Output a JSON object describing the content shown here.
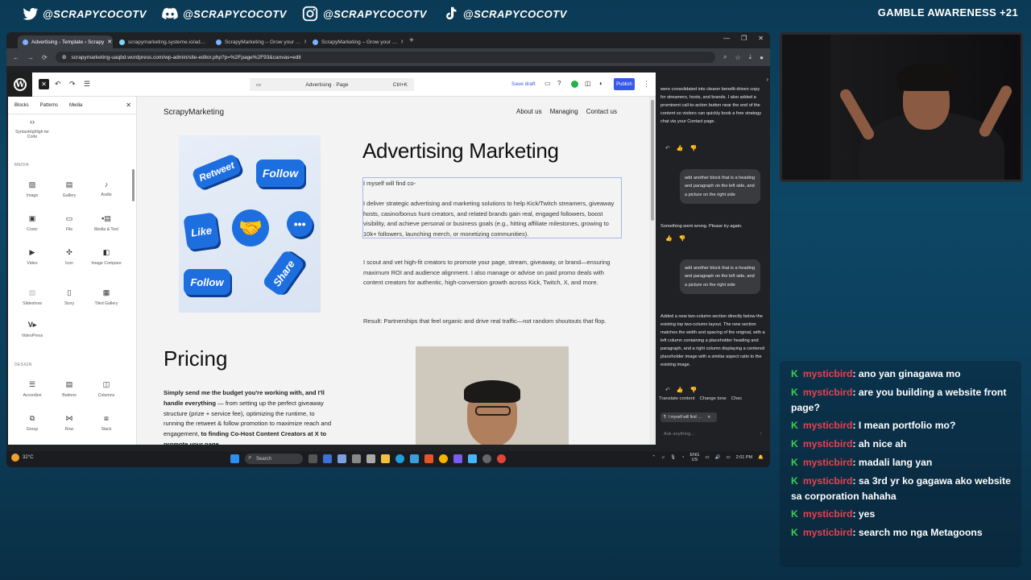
{
  "stream": {
    "handles": [
      {
        "icon": "twitter-icon",
        "text": "@SCRAPYCOCOTV"
      },
      {
        "icon": "discord-icon",
        "text": "@SCRAPYCOCOTV"
      },
      {
        "icon": "instagram-icon",
        "text": "@SCRAPYCOCOTV"
      },
      {
        "icon": "tiktok-icon",
        "text": "@SCRAPYCOCOTV"
      }
    ],
    "gamble_notice": "GAMBLE AWARENESS +21"
  },
  "browser": {
    "tabs": [
      {
        "label": "Advertising - Template ‹ Scrapy",
        "active": true
      },
      {
        "label": "scrapymarketing.systeme.io/ad…",
        "active": false
      },
      {
        "label": "ScrapyMarketing – Grow your …",
        "active": false
      },
      {
        "label": "ScrapyMarketing – Grow your …",
        "active": false
      }
    ],
    "new_tab": "+",
    "url": "scrapymarketing-uaqbd.wordpress.com/wp-admin/site-editor.php?p=%2Fpage%2F93&canvas=edit"
  },
  "wp": {
    "logo": "W",
    "doc_title": "Advertising · Page",
    "shortcut": "Ctrl+K",
    "save_draft": "Save draft",
    "publish": "Publish",
    "inserter_tabs": [
      "Blocks",
      "Patterns",
      "Media"
    ],
    "top_block": "SyntaxHighligh ter Code",
    "sections": {
      "media": "MEDIA",
      "design": "DESIGN"
    },
    "media_blocks": [
      "Image",
      "Gallery",
      "Audio",
      "Cover",
      "File",
      "Media & Text",
      "Video",
      "Icon",
      "Image Compare",
      "Slideshow",
      "Story",
      "Tiled Gallery",
      "VideoPress"
    ],
    "design_blocks": [
      "Accordion",
      "Buttons",
      "Columns",
      "Group",
      "Row",
      "Stack"
    ]
  },
  "site": {
    "name": "ScrapyMarketing",
    "nav": [
      "About us",
      "Managing",
      "Contact us"
    ],
    "image_words": [
      "Retweet",
      "Follow",
      "Like",
      "Follow",
      "Share"
    ],
    "heading": "Advertising Marketing",
    "draft_line": "I myself will find co-",
    "para1": "I deliver strategic advertising and marketing solutions to help Kick/Twitch streamers, giveaway hosts, casino/bonus hunt creators, and related brands gain real, engaged followers, boost visibility, and achieve personal or business goals (e.g., hitting affiliate milestones, growing to 10k+ followers, launching merch, or monetizing communities).",
    "para2": "I scout and vet high-fit creators to promote your page, stream, giveaway, or brand—ensuring maximum ROI and audience alignment. I also manage or advise on paid promo deals with content creators for authentic, high-conversion growth across Kick, Twitch, X, and more.",
    "para3": "Result: Partnerships that feel organic and drive real traffic—not random shoutouts that flop.",
    "pricing_heading": "Pricing",
    "pricing_bold1": "Simply send me the budget you're working with, and I'll handle everything",
    "pricing_text": " — from setting up the perfect giveaway structure (prize + service fee), optimizing the runtime, to running the retweet & follow promotion to maximize reach and engagement, ",
    "pricing_bold2": "to finding Co-Host Content Creators at X to promote your page"
  },
  "ai_panel": {
    "msg1": "were consolidated into clearer benefit-driven copy for streamers, hosts, and brands. I also added a prominent call-to-action button near the end of the content so visitors can quickly book a free strategy chat via your Contact page.",
    "user1": "add another block that is a heading and paragraph on the left side, and a picture on the right side",
    "error": "Something went wrong. Please try again.",
    "user2": "add another block that is a heading and paragraph on the left side, and a picture on the right side",
    "msg2": "Added a new two-column section directly below the existing top two-column layout. The new section matches the width and spacing of the original, with a left column containing a placeholder heading and paragraph, and a right column displaying a centered placeholder image with a similar aspect ratio to the existing image.",
    "actions": [
      "Translate content",
      "Change tone",
      "Chec"
    ],
    "chip": "I myself will find …",
    "input_placeholder": "Ask anything..."
  },
  "taskbar": {
    "temp": "32°C",
    "search": "Search",
    "lang": "ENG",
    "region": "US",
    "time": "2:01 PM"
  },
  "chat": [
    {
      "user": "mysticbird",
      "text": ": ano yan ginagawa mo"
    },
    {
      "user": "mysticbird",
      "text": ": are you building a website front page?"
    },
    {
      "user": "mysticbird",
      "text": ": I mean portfolio mo?"
    },
    {
      "user": "mysticbird",
      "text": ": ah nice ah"
    },
    {
      "user": "mysticbird",
      "text": ": madali lang yan"
    },
    {
      "user": "mysticbird",
      "text": ": sa 3rd yr ko gagawa ako website sa corporation hahaha"
    },
    {
      "user": "mysticbird",
      "text": ": yes"
    },
    {
      "user": "mysticbird",
      "text": ": search mo nga Metagoons"
    }
  ],
  "colors": {
    "wp_blue": "#3858e9",
    "chat_user": "#e8414d",
    "chat_badge": "#3cd14b"
  }
}
